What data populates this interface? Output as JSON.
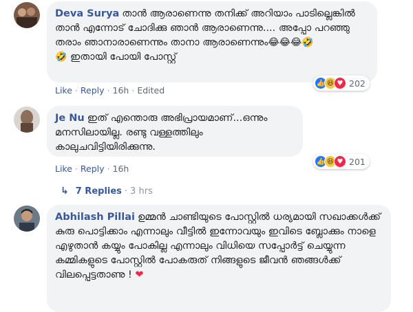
{
  "comments": [
    {
      "author": "Deva Surya",
      "text": "താൻ ആരാണെന്നു തനിക്ക് അറിയാം പാടില്ലെങ്കിൽ താൻ എന്നോട് ചോദിക്കു ഞാൻ ആരാണെന്നു.... അപ്പോ പറഞ്ഞു തരാം ഞാനാരാണെന്നും താനാ ആരാണെന്നും",
      "text_tail": "ഇതായി പോയി പോസ്റ്റ്",
      "emojis": "😂😂😂🤣",
      "emoji_lead": "🤣",
      "like_label": "Like",
      "reply_label": "Reply",
      "time": "16h",
      "edited": "Edited",
      "reaction_count": "202"
    },
    {
      "author": "Je Nu",
      "text": "ഇത് എന്തൊരു അഭിപ്രായമാണ്...ഒന്നും മനസിലായില്ല. രണ്ടു വള്ളത്തിലും കാലുചവിട്ടിയിരിക്കുന്നു.",
      "like_label": "Like",
      "reply_label": "Reply",
      "time": "16h",
      "reaction_count": "201"
    },
    {
      "author": "Abhilash Pillai",
      "text": "ഉമ്മൻ ചാണ്ടിയുടെ പോസ്റ്റിൽ ധര്യമായി സഖാക്കൾക്ക് കുരു പൊട്ടിക്കാം എന്നാലും വീട്ടിൽ ഇന്നോവയും ഇവിടെ ബ്ലോക്കും നാളെ എഴുതാൻ കയ്യും പോകില്ല എന്നാലും വിധിയെ സപ്പോർട്ട് ചെയ്യുന്ന കമ്മികളുടെ പോസ്റ്റിൽ പോകരുത് നിങ്ങളുടെ ജീവൻ ഞങ്ങൾക്ക് വിലപ്പെട്ടതാണു !",
      "heart": "❤"
    }
  ],
  "replies": {
    "label": "7 Replies",
    "separator": "·",
    "time": "3 hrs"
  },
  "colors": {
    "link": "#385898",
    "bubble": "#f2f3f5",
    "like_blue": "#2078f4",
    "haha_yellow": "#f7c84a",
    "love_red": "#f0284a"
  }
}
